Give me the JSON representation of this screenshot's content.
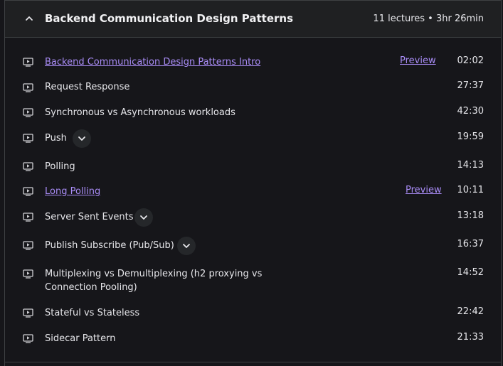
{
  "section": {
    "title": "Backend Communication Design Patterns",
    "meta": "11 lectures • 3hr 26min",
    "collapse_icon": "chevron-up-icon"
  },
  "lectures": [
    {
      "title": "Backend Communication Design Patterns Intro",
      "duration": "02:02",
      "preview": "Preview",
      "icon": "play-video-icon"
    },
    {
      "title": "Request Response",
      "duration": "27:37",
      "icon": "play-video-icon"
    },
    {
      "title": "Synchronous vs Asynchronous workloads",
      "duration": "42:30",
      "icon": "play-video-icon"
    },
    {
      "title": "Push",
      "duration": "19:59",
      "icon": "play-video-icon",
      "expand_icon": "chevron-down-icon"
    },
    {
      "title": "Polling",
      "duration": "14:13",
      "icon": "play-video-icon"
    },
    {
      "title": "Long Polling",
      "duration": "10:11",
      "preview": "Preview",
      "icon": "play-video-icon"
    },
    {
      "title": "Server Sent Events",
      "duration": "13:18",
      "icon": "play-video-icon",
      "expand_icon": "chevron-down-icon"
    },
    {
      "title": "Publish Subscribe (Pub/Sub)",
      "duration": "16:37",
      "icon": "play-video-icon",
      "expand_icon": "chevron-down-icon"
    },
    {
      "title": "Multiplexing vs Demultiplexing (h2 proxying vs Connection Pooling)",
      "duration": "14:52",
      "icon": "play-video-icon"
    },
    {
      "title": "Stateful vs Stateless",
      "duration": "22:42",
      "icon": "play-video-icon"
    },
    {
      "title": "Sidecar Pattern",
      "duration": "21:33",
      "icon": "play-video-icon"
    }
  ],
  "colors": {
    "background": "#16161a",
    "header_background": "#1f2022",
    "link": "#a98cf6",
    "border": "#3e4143"
  }
}
